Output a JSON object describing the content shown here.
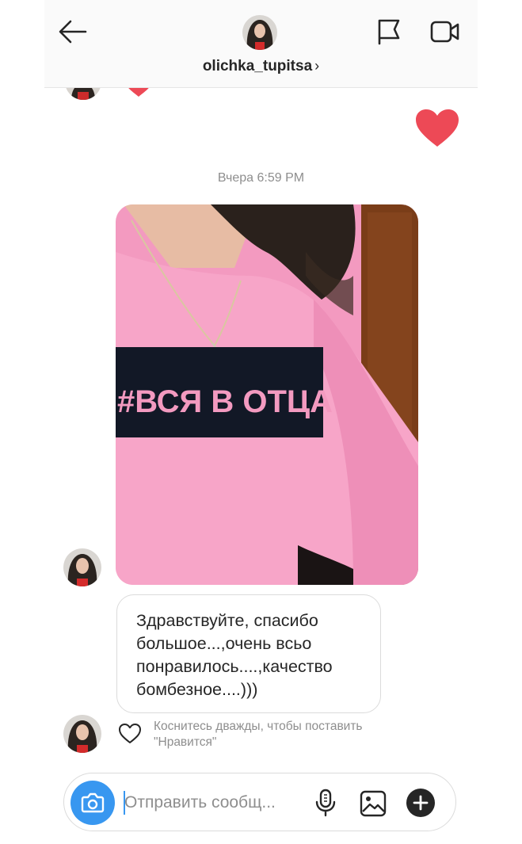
{
  "header": {
    "username": "olichka_tupitsa",
    "chevron": "›",
    "icons": [
      "back-arrow-icon",
      "flag-icon",
      "video-camera-icon"
    ]
  },
  "thread": {
    "timestamp": "Вчера 6:59 PM",
    "photo": {
      "shirt_text": "#ВСЯ В ОТЦА",
      "colors": {
        "shirt": "#f39ac0",
        "band": "#121826",
        "hair": "#2a211c",
        "door": "#7a3d18"
      }
    },
    "message": {
      "lines": [
        "Здравствуйте, спасибо",
        "большое...,очень всьо",
        "понравилось....,качество",
        "бомбезное....)))"
      ]
    },
    "like_hint": {
      "line1": "Коснитесь дважды, чтобы поставить",
      "line2": "\"Нравится\""
    },
    "reaction_color": "#ed4956"
  },
  "composer": {
    "placeholder": "Отправить сообщ...",
    "icons": [
      "camera-icon",
      "microphone-icon",
      "gallery-icon",
      "plus-icon"
    ],
    "accent": "#3897f0"
  }
}
